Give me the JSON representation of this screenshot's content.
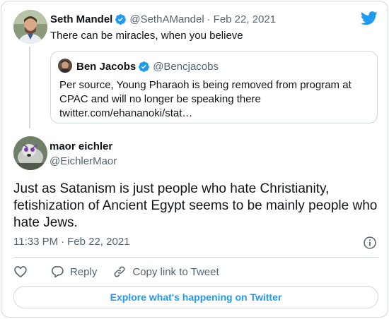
{
  "parent_tweet": {
    "author_name": "Seth Mandel",
    "handle": "@SethAMandel",
    "separator": "·",
    "date": "Feb 22, 2021",
    "text": "There can be miracles, when you believe"
  },
  "quoted_tweet": {
    "author_name": "Ben Jacobs",
    "handle": "@Bencjacobs",
    "text": "Per source, Young Pharaoh is being removed from program at CPAC and will no longer be speaking there twitter.com/ehananoki/stat…"
  },
  "main_tweet": {
    "author_name": "maor eichler",
    "handle": "@EichlerMaor",
    "text": "Just as Satanism is just people who hate Christianity, fetishization of Ancient Egypt seems to be mainly people who hate Jews.",
    "time": "11:33 PM",
    "separator": "·",
    "date": "Feb 22, 2021"
  },
  "actions": {
    "like_icon": "heart-icon",
    "reply_label": "Reply",
    "copy_label": "Copy link to Tweet"
  },
  "explore_button": "Explore what's happening on Twitter",
  "colors": {
    "accent": "#1d9bf0",
    "text": "#0f1419",
    "muted": "#536471",
    "border": "#cfd9de"
  }
}
